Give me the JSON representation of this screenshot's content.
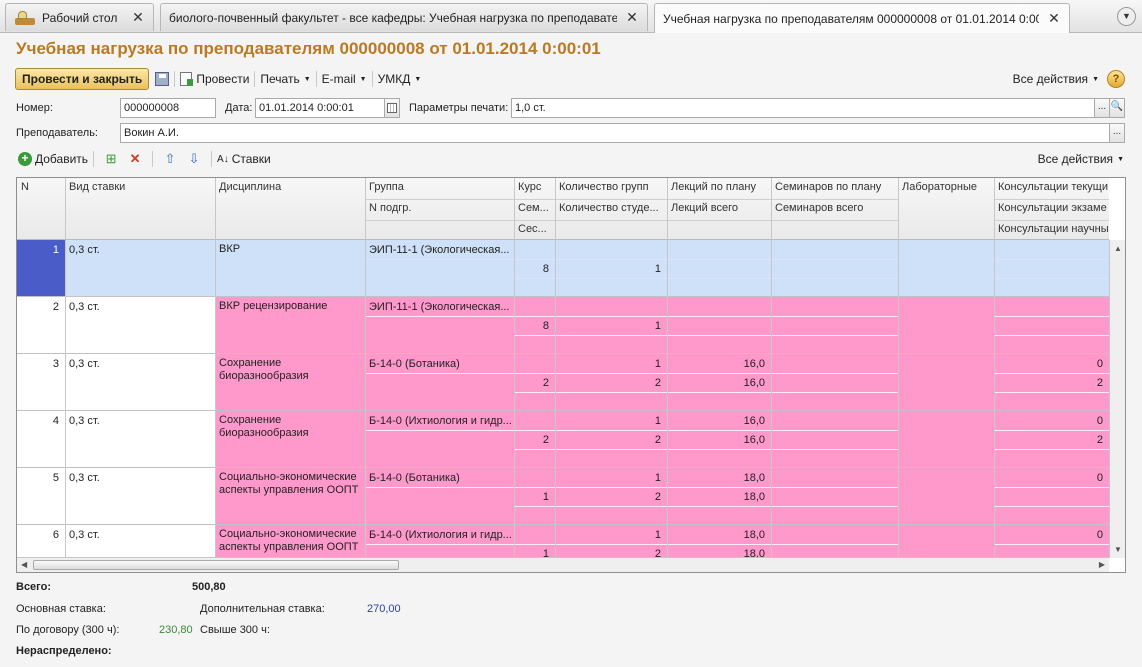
{
  "tabs": [
    {
      "label": "Рабочий стол",
      "close": "✕"
    },
    {
      "label": "биолого-почвенный факультет - все кафедры: Учебная нагрузка по преподавателям",
      "close": "✕"
    },
    {
      "label": "Учебная нагрузка по преподавателям 000000008 от 01.01.2014 0:00:01",
      "close": "✕"
    }
  ],
  "title": "Учебная нагрузка по преподавателям 000000008 от 01.01.2014 0:00:01",
  "toolbar": {
    "post_close": "Провести и закрыть",
    "post": "Провести",
    "print": "Печать",
    "email": "E-mail",
    "umkd": "УМКД",
    "all_actions": "Все действия",
    "help": "?"
  },
  "fields": {
    "number_label": "Номер:",
    "number_value": "000000008",
    "date_label": "Дата:",
    "date_value": "01.01.2014  0:00:01",
    "print_params_label": "Параметры печати:",
    "print_params_value": "1,0 ст.",
    "teacher_label": "Преподаватель:",
    "teacher_value": "Вокин А.И.",
    "ellipsis": "...",
    "search_glyph": "🔍"
  },
  "table_toolbar": {
    "add": "Добавить",
    "rates": "Ставки",
    "all_actions": "Все действия"
  },
  "columns": [
    [
      "N",
      "",
      ""
    ],
    [
      "Вид ставки",
      "",
      ""
    ],
    [
      "Дисциплина",
      "",
      ""
    ],
    [
      "Группа",
      "N подгр.",
      ""
    ],
    [
      "Курс",
      "Сем...",
      "Сес..."
    ],
    [
      "Количество групп",
      "Количество студе...",
      ""
    ],
    [
      "Лекций  по плану",
      "Лекций всего",
      ""
    ],
    [
      "Семинаров  по плану",
      "Семинаров всего",
      ""
    ],
    [
      "Лабораторные",
      "",
      ""
    ],
    [
      "Консультации текущи",
      "Консультации экзаме",
      "Консультации научны"
    ]
  ],
  "rows": [
    {
      "n": "1",
      "rate": "0,3 ст.",
      "discipline": "ВКР",
      "group": "ЭИП-11-1 (Экологическая...",
      "course": "",
      "groups_count": "",
      "lectures_plan": "",
      "consult": "",
      "semester": "8",
      "students": "1",
      "lectures_total": "",
      "consult2": "",
      "selected": true
    },
    {
      "n": "2",
      "rate": "0,3 ст.",
      "discipline": "ВКР рецензирование",
      "group": "ЭИП-11-1 (Экологическая...",
      "course": "",
      "groups_count": "",
      "lectures_plan": "",
      "consult": "",
      "semester": "8",
      "students": "1",
      "lectures_total": "",
      "consult2": ""
    },
    {
      "n": "3",
      "rate": "0,3 ст.",
      "discipline": "Сохранение биоразнообразия",
      "group": "Б-14-0 (Ботаника)",
      "course": "",
      "groups_count": "1",
      "lectures_plan": "16,0",
      "consult": "0",
      "semester": "2",
      "students": "2",
      "lectures_total": "16,0",
      "consult2": "2"
    },
    {
      "n": "4",
      "rate": "0,3 ст.",
      "discipline": "Сохранение биоразнообразия",
      "group": "Б-14-0 (Ихтиология и гидр...",
      "course": "",
      "groups_count": "1",
      "lectures_plan": "16,0",
      "consult": "0",
      "semester": "2",
      "students": "2",
      "lectures_total": "16,0",
      "consult2": "2"
    },
    {
      "n": "5",
      "rate": "0,3 ст.",
      "discipline": "Социально-экономические аспекты управления ООПТ",
      "group": "Б-14-0 (Ботаника)",
      "course": "",
      "groups_count": "1",
      "lectures_plan": "18,0",
      "consult": "0",
      "semester": "1",
      "students": "2",
      "lectures_total": "18,0",
      "consult2": ""
    },
    {
      "n": "6",
      "rate": "0,3 ст.",
      "discipline": "Социально-экономические аспекты управления ООПТ",
      "group": "Б-14-0 (Ихтиология и гидр...",
      "course": "",
      "groups_count": "1",
      "lectures_plan": "18,0",
      "consult": "0",
      "semester": "1",
      "students": "2",
      "lectures_total": "18,0",
      "consult2": ""
    }
  ],
  "footer": {
    "total_label": "Всего:",
    "total_value": "500,80",
    "main_rate_label": "Основная ставка:",
    "extra_rate_label": "Дополнительная ставка:",
    "extra_rate_value": "270,00",
    "contract_label": "По договору (300 ч):",
    "contract_value": "230,80",
    "over_label": "Свыше 300 ч:",
    "unassigned_label": "Нераспределено:"
  },
  "colors": {
    "pink": "#ff99cc",
    "selected_row": "#cfe1f8",
    "selected_cell": "#4a5cc8",
    "title": "#bb7a22",
    "contract_value": "#3a8a3a",
    "extra_rate_value": "#2a3fb0"
  }
}
